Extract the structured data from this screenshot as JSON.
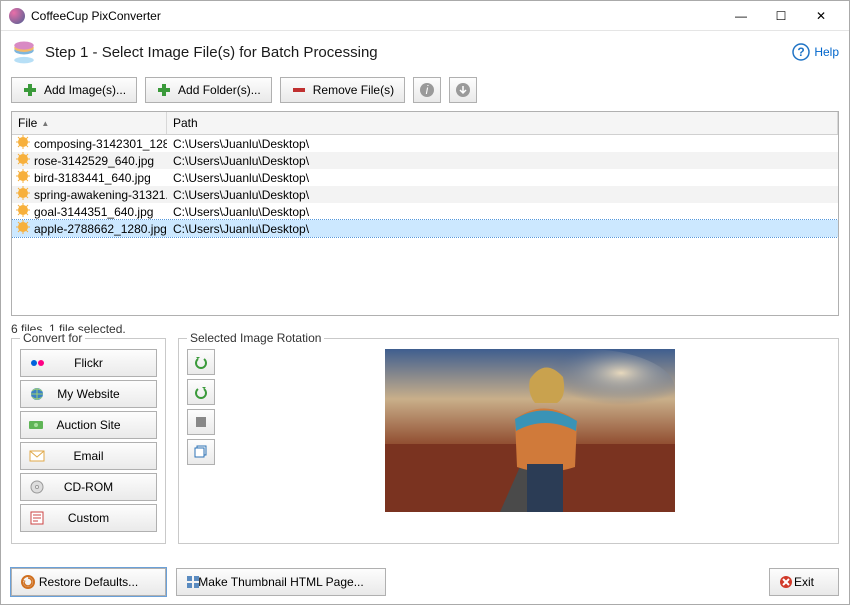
{
  "window": {
    "title": "CoffeeCup PixConverter",
    "minimize": "—",
    "maximize": "☐",
    "close": "✕"
  },
  "step": {
    "text": "Step 1 - Select Image File(s) for Batch Processing",
    "help": "Help"
  },
  "toolbar": {
    "add_image": "Add Image(s)...",
    "add_folder": "Add Folder(s)...",
    "remove": "Remove File(s)"
  },
  "columns": {
    "file": "File",
    "path": "Path"
  },
  "files": [
    {
      "name": "composing-3142301_128...",
      "path": "C:\\Users\\Juanlu\\Desktop\\",
      "selected": false
    },
    {
      "name": "rose-3142529_640.jpg",
      "path": "C:\\Users\\Juanlu\\Desktop\\",
      "selected": false
    },
    {
      "name": "bird-3183441_640.jpg",
      "path": "C:\\Users\\Juanlu\\Desktop\\",
      "selected": false
    },
    {
      "name": "spring-awakening-31321...",
      "path": "C:\\Users\\Juanlu\\Desktop\\",
      "selected": false
    },
    {
      "name": "goal-3144351_640.jpg",
      "path": "C:\\Users\\Juanlu\\Desktop\\",
      "selected": false
    },
    {
      "name": "apple-2788662_1280.jpg",
      "path": "C:\\Users\\Juanlu\\Desktop\\",
      "selected": true
    }
  ],
  "status": "6 files, 1 file selected.",
  "convert": {
    "legend": "Convert for",
    "flickr": "Flickr",
    "my_website": "My Website",
    "auction": "Auction Site",
    "email": "Email",
    "cdrom": "CD-ROM",
    "custom": "Custom"
  },
  "rotation": {
    "legend": "Selected Image Rotation"
  },
  "footer": {
    "restore": "Restore Defaults...",
    "thumbnail": "Make Thumbnail HTML Page...",
    "exit": "Exit"
  }
}
